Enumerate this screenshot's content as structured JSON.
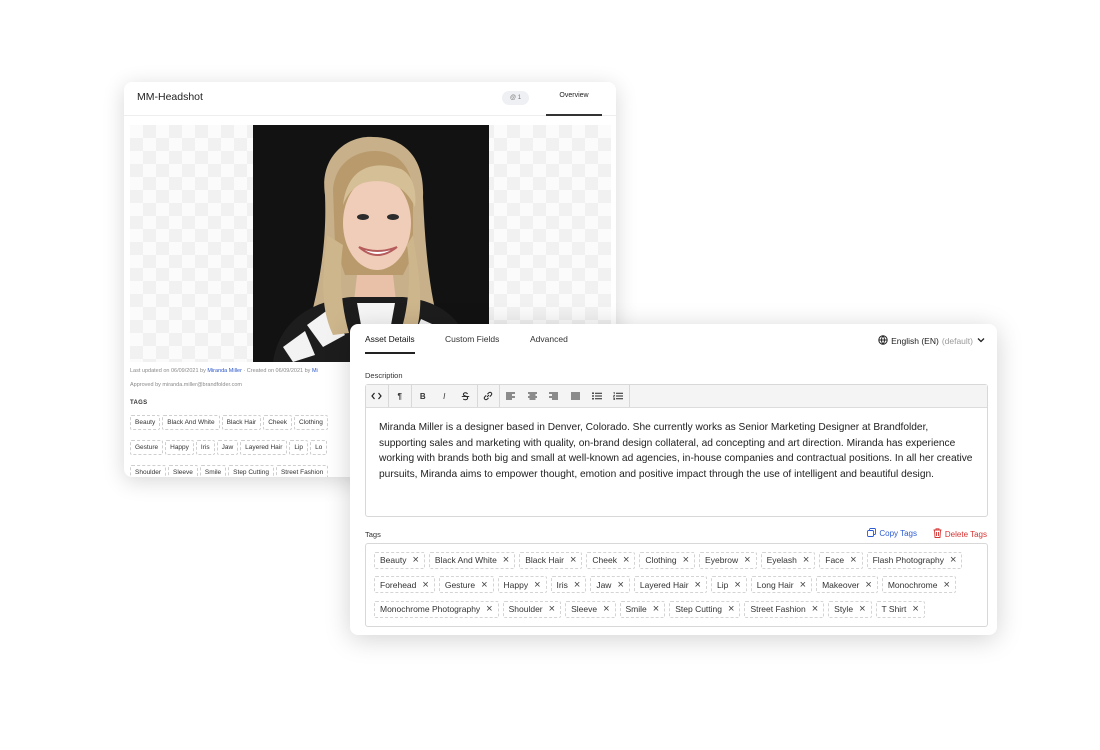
{
  "back_card": {
    "title": "MM-Headshot",
    "badge": "@ 1",
    "tab": "Overview",
    "meta_updated_prefix": "Last updated on 06/09/2021 by ",
    "meta_user": "Miranda Miller",
    "meta_created": " · Created on 06/09/2021 by ",
    "meta_created_user": "Mi",
    "meta_approved": "Approved by miranda.miller@brandfolder.com",
    "tags_label": "TAGS",
    "tags": [
      "Beauty",
      "Black And White",
      "Black Hair",
      "Cheek",
      "Clothing",
      "Gesture",
      "Happy",
      "Iris",
      "Jaw",
      "Layered Hair",
      "Lip",
      "Lo",
      "Shoulder",
      "Sleeve",
      "Smile",
      "Step Cutting",
      "Street Fashion"
    ]
  },
  "front_card": {
    "tabs": [
      "Asset Details",
      "Custom Fields",
      "Advanced"
    ],
    "language": "English (EN)",
    "language_note": "(default)",
    "description_label": "Description",
    "description": "Miranda Miller is a designer based in Denver, Colorado. She currently works as Senior Marketing Designer at Brandfolder, supporting sales and marketing with quality, on-brand design collateral, ad concepting and art direction. Miranda has experience working with brands both big and small at well-known ad agencies, in-house companies and contractual positions. In all her creative pursuits, Miranda aims to empower thought, emotion and positive impact through the use of intelligent and beautiful design.",
    "tags_label": "Tags",
    "copy_tags": "Copy Tags",
    "delete_tags": "Delete Tags",
    "tags": [
      "Beauty",
      "Black And White",
      "Black Hair",
      "Cheek",
      "Clothing",
      "Eyebrow",
      "Eyelash",
      "Face",
      "Flash Photography",
      "Forehead",
      "Gesture",
      "Happy",
      "Iris",
      "Jaw",
      "Layered Hair",
      "Lip",
      "Long Hair",
      "Makeover",
      "Monochrome",
      "Monochrome Photography",
      "Shoulder",
      "Sleeve",
      "Smile",
      "Step Cutting",
      "Street Fashion",
      "Style",
      "T Shirt"
    ],
    "toolbar_icons": [
      "code-icon",
      "paragraph-icon",
      "bold-icon",
      "italic-icon",
      "strikethrough-icon",
      "link-icon",
      "align-left-icon",
      "align-center-icon",
      "align-right-icon",
      "align-justify-icon",
      "bullet-list-icon",
      "numbered-list-icon"
    ],
    "toolbar_glyphs": {
      "paragraph": "¶",
      "bold": "B",
      "italic": "I"
    }
  },
  "colors": {
    "link_blue": "#2d5bd0",
    "delete_red": "#d63333",
    "photo_bg": "#121212"
  }
}
